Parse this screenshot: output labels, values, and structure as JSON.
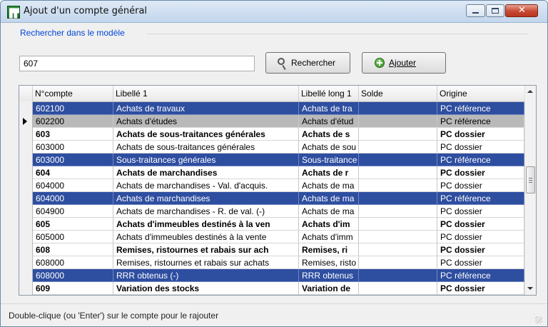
{
  "window": {
    "title": "Ajout d'un compte général",
    "icon": "ledger-app-icon"
  },
  "search": {
    "group_label": "Rechercher dans le modèle",
    "value": "607",
    "search_button_label": "Rechercher",
    "add_button_label": "Ajouter"
  },
  "table": {
    "headers": [
      "N°compte",
      "Libellé 1",
      "Libellé long 1",
      "Solde",
      "Origine"
    ],
    "rows": [
      {
        "compte": "602100",
        "libelle": "Achats de travaux",
        "libelle_long": "Achats de tra",
        "solde": "",
        "origine": "PC référence",
        "selected": true,
        "bold": false
      },
      {
        "compte": "602200",
        "libelle": "Achats d'études",
        "libelle_long": "Achats d'étud",
        "solde": "",
        "origine": "PC référence",
        "current": true,
        "bold": false
      },
      {
        "compte": "603",
        "libelle": "Achats de sous-traitances générales",
        "libelle_long": "Achats de s",
        "solde": "",
        "origine": "PC dossier",
        "bold": true
      },
      {
        "compte": "603000",
        "libelle": "Achats de sous-traitances générales",
        "libelle_long": "Achats de sou",
        "solde": "",
        "origine": "PC dossier",
        "bold": false
      },
      {
        "compte": "603000",
        "libelle": "Sous-traitances générales",
        "libelle_long": "Sous-traitance",
        "solde": "",
        "origine": "PC référence",
        "selected": true,
        "bold": false
      },
      {
        "compte": "604",
        "libelle": "Achats de marchandises",
        "libelle_long": "Achats de r",
        "solde": "",
        "origine": "PC dossier",
        "bold": true
      },
      {
        "compte": "604000",
        "libelle": "Achats de marchandises - Val. d'acquis.",
        "libelle_long": "Achats de ma",
        "solde": "",
        "origine": "PC dossier",
        "bold": false
      },
      {
        "compte": "604000",
        "libelle": "Achats de marchandises",
        "libelle_long": "Achats de ma",
        "solde": "",
        "origine": "PC référence",
        "selected": true,
        "bold": false
      },
      {
        "compte": "604900",
        "libelle": "Achats de marchandises - R. de val. (-)",
        "libelle_long": "Achats de ma",
        "solde": "",
        "origine": "PC dossier",
        "bold": false
      },
      {
        "compte": "605",
        "libelle": "Achats d'immeubles destinés à la ven",
        "libelle_long": "Achats d'im",
        "solde": "",
        "origine": "PC dossier",
        "bold": true
      },
      {
        "compte": "605000",
        "libelle": "Achats d'immeubles destinés à la vente",
        "libelle_long": "Achats d'imm",
        "solde": "",
        "origine": "PC dossier",
        "bold": false
      },
      {
        "compte": "608",
        "libelle": "Remises, ristournes et rabais sur ach",
        "libelle_long": "Remises, ri",
        "solde": "",
        "origine": "PC dossier",
        "bold": true
      },
      {
        "compte": "608000",
        "libelle": "Remises, ristournes et rabais sur achats",
        "libelle_long": "Remises, risto",
        "solde": "",
        "origine": "PC dossier",
        "bold": false
      },
      {
        "compte": "608000",
        "libelle": "RRR obtenus (-)",
        "libelle_long": "RRR obtenus",
        "solde": "",
        "origine": "PC référence",
        "selected": true,
        "bold": false
      },
      {
        "compte": "609",
        "libelle": "Variation des stocks",
        "libelle_long": "Variation de",
        "solde": "",
        "origine": "PC dossier",
        "bold": true
      }
    ]
  },
  "status": {
    "text": "Double-clique (ou 'Enter') sur le compte pour le rajouter"
  },
  "colors": {
    "selection": "#2e4ea0",
    "current_row": "#b9b9b9",
    "group_label": "#0046d5",
    "close_button": "#c64a33"
  }
}
